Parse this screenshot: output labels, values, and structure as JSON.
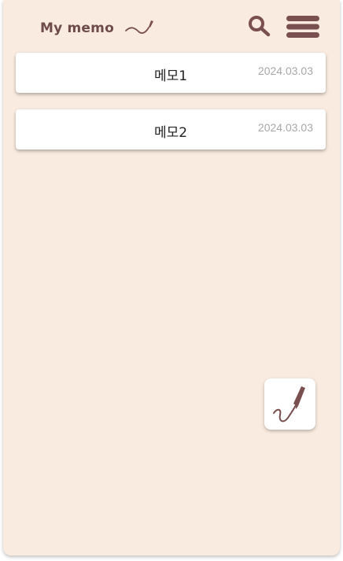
{
  "header": {
    "title": "My memo",
    "doodle_icon": "pen-squiggle-icon",
    "search_icon": "search-icon",
    "menu_icon": "hamburger-menu-icon"
  },
  "memos": [
    {
      "title": "메모1",
      "date": "2024.03.03"
    },
    {
      "title": "메모2",
      "date": "2024.03.03"
    }
  ],
  "fab": {
    "icon": "pen-write-icon"
  },
  "colors": {
    "background": "#f9ebdf",
    "accent": "#7a4f4f",
    "card": "#ffffff",
    "date_text": "#a8a8a8"
  }
}
